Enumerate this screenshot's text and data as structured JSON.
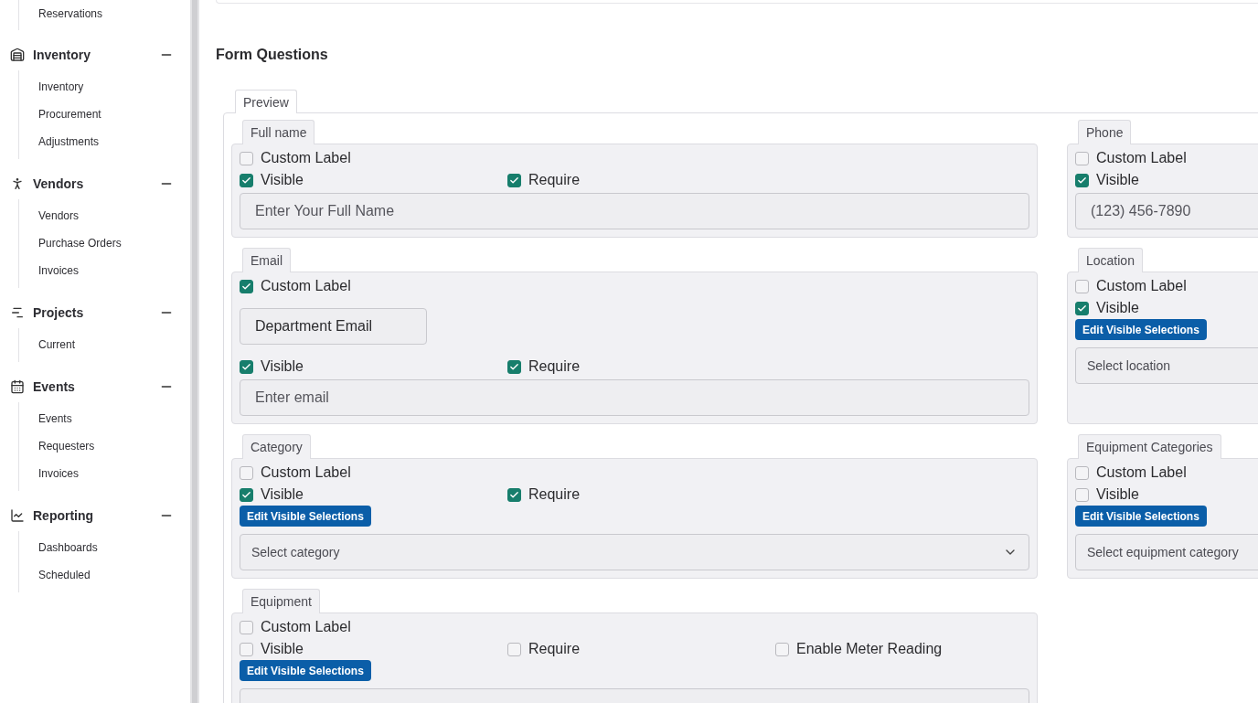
{
  "sidebar": {
    "top_item": "Reservations",
    "groups": [
      {
        "title": "Inventory",
        "expanded": true,
        "items": [
          "Inventory",
          "Procurement",
          "Adjustments"
        ]
      },
      {
        "title": "Vendors",
        "expanded": true,
        "items": [
          "Vendors",
          "Purchase Orders",
          "Invoices"
        ]
      },
      {
        "title": "Projects",
        "expanded": true,
        "items": [
          "Current"
        ]
      },
      {
        "title": "Events",
        "expanded": true,
        "items": [
          "Events",
          "Requesters",
          "Invoices"
        ]
      },
      {
        "title": "Reporting",
        "expanded": true,
        "items": [
          "Dashboards",
          "Scheduled"
        ]
      }
    ]
  },
  "form": {
    "title": "Form Questions",
    "preview_legend": "Preview",
    "rows": [
      [
        {
          "legend": "Full name",
          "custom_label": {
            "label": "Custom Label",
            "checked": false
          },
          "toggles": [
            {
              "label": "Visible",
              "checked": true
            },
            {
              "label": "Require",
              "checked": true
            }
          ],
          "input": {
            "kind": "text",
            "placeholder": "Enter Your Full Name"
          }
        },
        {
          "legend": "Phone",
          "custom_label": {
            "label": "Custom Label",
            "checked": false
          },
          "toggles": [
            {
              "label": "Visible",
              "checked": true
            }
          ],
          "input": {
            "kind": "text",
            "placeholder": "(123) 456-7890"
          }
        }
      ],
      [
        {
          "legend": "Email",
          "custom_label": {
            "label": "Custom Label",
            "checked": true
          },
          "custom_value": "Department Email",
          "toggles": [
            {
              "label": "Visible",
              "checked": true
            },
            {
              "label": "Require",
              "checked": true
            }
          ],
          "input": {
            "kind": "text",
            "placeholder": "Enter email"
          }
        },
        {
          "legend": "Location",
          "custom_label": {
            "label": "Custom Label",
            "checked": false
          },
          "toggles": [
            {
              "label": "Visible",
              "checked": true
            }
          ],
          "button": "Edit Visible Selections",
          "input": {
            "kind": "select",
            "placeholder": "Select location"
          }
        }
      ],
      [
        {
          "legend": "Category",
          "custom_label": {
            "label": "Custom Label",
            "checked": false
          },
          "toggles": [
            {
              "label": "Visible",
              "checked": true
            },
            {
              "label": "Require",
              "checked": true
            }
          ],
          "button": "Edit Visible Selections",
          "input": {
            "kind": "select",
            "placeholder": "Select category",
            "chevron": true
          }
        },
        {
          "legend": "Equipment Categories",
          "custom_label": {
            "label": "Custom Label",
            "checked": false
          },
          "toggles": [
            {
              "label": "Visible",
              "checked": false
            }
          ],
          "button": "Edit Visible Selections",
          "input": {
            "kind": "select",
            "placeholder": "Select equipment category"
          }
        }
      ],
      [
        {
          "legend": "Equipment",
          "custom_label": {
            "label": "Custom Label",
            "checked": false
          },
          "toggles": [
            {
              "label": "Visible",
              "checked": false
            },
            {
              "label": "Require",
              "checked": false
            },
            {
              "label": "Enable Meter Reading",
              "checked": false
            }
          ],
          "button": "Edit Visible Selections",
          "input": {
            "kind": "select"
          }
        }
      ]
    ]
  }
}
